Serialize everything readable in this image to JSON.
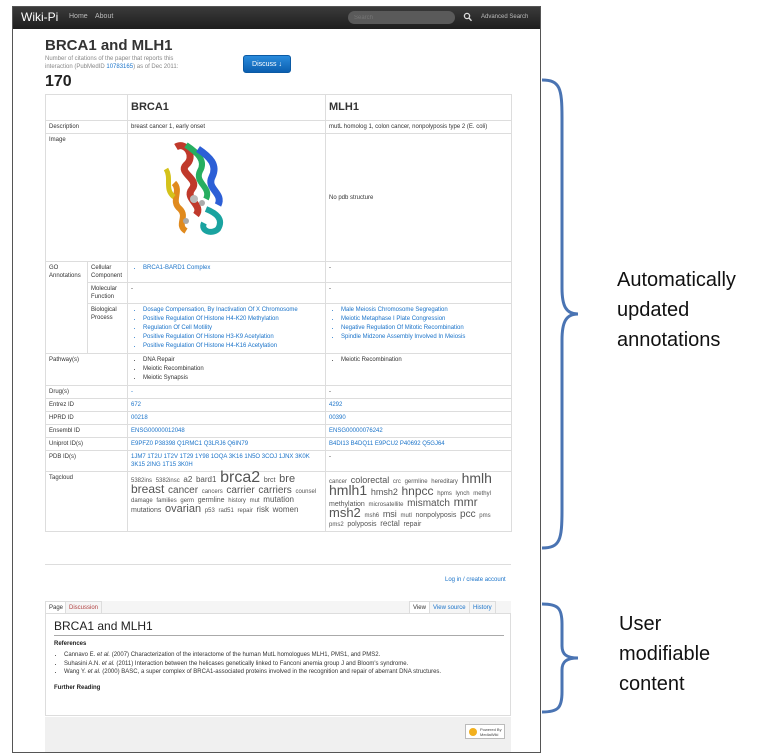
{
  "nav": {
    "brand": "Wiki-Pi",
    "home": "Home",
    "about": "About",
    "search_placeholder": "Search",
    "advanced_search": "Advanced Search"
  },
  "page": {
    "title": "BRCA1 and MLH1",
    "citation_note": "Number of citations of the paper that reports this interaction (PubMedID ",
    "pubmed_id": "10783165",
    "citation_note_end": ") as of Dec 2011:",
    "citation_count": "170",
    "discuss_label": "Discuss ↓"
  },
  "table": {
    "col1": "BRCA1",
    "col2": "MLH1",
    "description_label": "Description",
    "desc1": "breast cancer 1, early onset",
    "desc2": "mutL homolog 1, colon cancer, nonpolyposis type 2 (E. coli)",
    "image_label": "Image",
    "image2": "No pdb structure",
    "go_label": "GO Annotations",
    "cc_label": "Cellular Component",
    "cc1": [
      "BRCA1-BARD1 Complex"
    ],
    "cc2": "-",
    "mf_label": "Molecular Function",
    "mf1": "-",
    "mf2": "-",
    "bp_label": "Biological Process",
    "bp1": [
      "Dosage Compensation, By Inactivation Of X Chromosome",
      "Positive Regulation Of Histone H4-K20 Methylation",
      "Regulation Of Cell Motility",
      "Positive Regulation Of Histone H3-K9 Acetylation",
      "Positive Regulation Of Histone H4-K16 Acetylation"
    ],
    "bp2": [
      "Male Meiosis Chromosome Segregation",
      "Meiotic Metaphase I Plate Congression",
      "Negative Regulation Of Mitotic Recombination",
      "Spindle Midzone Assembly Involved In Meiosis"
    ],
    "pathway_label": "Pathway(s)",
    "pw1": [
      "DNA Repair",
      "Meiotic Recombination",
      "Meiotic Synapsis"
    ],
    "pw2": [
      "Meiotic Recombination"
    ],
    "drug_label": "Drug(s)",
    "drug1": "-",
    "drug2": "-",
    "entrez_label": "Entrez ID",
    "entrez1": "672",
    "entrez2": "4292",
    "hprd_label": "HPRD ID",
    "hprd1": "00218",
    "hprd2": "00390",
    "ensembl_label": "Ensembl ID",
    "ensembl1": "ENSG00000012048",
    "ensembl2": "ENSG00000076242",
    "uniprot_label": "Uniprot ID(s)",
    "uniprot1": "E9PFZ0 P38398 Q1RMC1 Q3LRJ6 Q6IN79",
    "uniprot2": "B4DI13 B4DQ11 E9PCU2 P40692 Q5GJ64",
    "pdb_label": "PDB ID(s)",
    "pdb1": "1JM7 1T2U 1T2V 1T29 1Y98 1OQA 3K16 1N5O 3COJ 1JNX 3K0K 3K15 2ING 1T15 3K0H",
    "pdb2": "-",
    "tagcloud_label": "Tagcloud",
    "tags1": [
      [
        "5382ins",
        6
      ],
      [
        "5382insc",
        6
      ],
      [
        "a2",
        8
      ],
      [
        "bard1",
        8
      ],
      [
        "brca2",
        16
      ],
      [
        "brct",
        7
      ],
      [
        "bre",
        11
      ],
      [
        "breast",
        12
      ],
      [
        "cancer",
        10
      ],
      [
        "cancers",
        6
      ],
      [
        "carrier",
        10
      ],
      [
        "carriers",
        10
      ],
      [
        "counsel",
        6
      ],
      [
        "damage",
        6
      ],
      [
        "families",
        6
      ],
      [
        "germ",
        6
      ],
      [
        "germline",
        7
      ],
      [
        "history",
        6
      ],
      [
        "mut",
        6
      ],
      [
        "mutation",
        8
      ],
      [
        "mutations",
        7
      ],
      [
        "ovarian",
        11
      ],
      [
        "p53",
        6
      ],
      [
        "rad51",
        6
      ],
      [
        "repair",
        6
      ],
      [
        "risk",
        8
      ],
      [
        "women",
        8
      ]
    ],
    "tags2": [
      [
        "cancer",
        6
      ],
      [
        "colorectal",
        9
      ],
      [
        "crc",
        6
      ],
      [
        "germline",
        6
      ],
      [
        "hereditary",
        6
      ],
      [
        "hmlh",
        14
      ],
      [
        "hmlh1",
        14
      ],
      [
        "hmsh2",
        9
      ],
      [
        "hnpcc",
        12
      ],
      [
        "hpms",
        6
      ],
      [
        "lynch",
        6
      ],
      [
        "methyl",
        6
      ],
      [
        "methylation",
        7
      ],
      [
        "microsatellite",
        6
      ],
      [
        "mismatch",
        10
      ],
      [
        "mmr",
        12
      ],
      [
        "msh2",
        13
      ],
      [
        "msh6",
        6
      ],
      [
        "msi",
        9
      ],
      [
        "mutl",
        6
      ],
      [
        "nonpolyposis",
        7
      ],
      [
        "pcc",
        10
      ],
      [
        "pms",
        6
      ],
      [
        "pms2",
        6
      ],
      [
        "polyposis",
        7
      ],
      [
        "rectal",
        8
      ],
      [
        "repair",
        7
      ]
    ]
  },
  "login_label": "Log in / create account",
  "wiki": {
    "tab_page": "Page",
    "tab_discussion": "Discussion",
    "tab_view": "View",
    "tab_view_source": "View source",
    "tab_history": "History",
    "title": "BRCA1 and MLH1",
    "references_label": "References",
    "refs": [
      {
        "author": "Cannavo E. ",
        "etal": "et al.",
        "text": " (2007) Characterization of the interactome of the human MutL homologues MLH1, PMS1, and PMS2."
      },
      {
        "author": "Suhasini A.N. ",
        "etal": "et al.",
        "text": " (2011) Interaction between the helicases genetically linked to Fanconi anemia group J and Bloom's syndrome."
      },
      {
        "author": "Wang Y. ",
        "etal": "et al.",
        "text": " (2000) BASC, a super complex of BRCA1-associated proteins involved in the recognition and repair of aberrant DNA structures."
      }
    ],
    "further_reading_label": "Further Reading",
    "powered_by": "Powered By MediaWiki"
  },
  "annotations": {
    "auto_line1": "Automatically",
    "auto_line2": "updated",
    "auto_line3": "annotations",
    "user_line1": "User",
    "user_line2": "modifiable",
    "user_line3": "content"
  },
  "colors": {
    "link": "#1a73c9",
    "navbar": "#1e1e1e",
    "discuss_button": "#0b5fb0",
    "bracket": "#4a74b3"
  }
}
